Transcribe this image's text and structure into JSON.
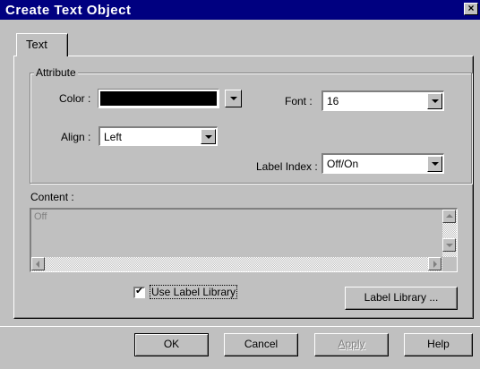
{
  "window": {
    "title": "Create Text Object",
    "close_glyph": "×"
  },
  "tabs": [
    {
      "label": "Text",
      "selected": true
    }
  ],
  "attribute": {
    "group_label": "Attribute",
    "color": {
      "label": "Color :",
      "value_color": "#000000"
    },
    "font": {
      "label": "Font :",
      "value": "16"
    },
    "align": {
      "label": "Align :",
      "value": "Left"
    },
    "label_index": {
      "label": "Label Index :",
      "value": "Off/On"
    }
  },
  "content": {
    "label": "Content :",
    "value": "Off"
  },
  "use_label_library": {
    "label": "Use Label Library",
    "checked": true,
    "check_glyph": "✔"
  },
  "label_library_button": "Label Library ...",
  "footer": {
    "ok": "OK",
    "cancel": "Cancel",
    "apply": "Apply",
    "help": "Help"
  },
  "colors": {
    "titlebar": "#000080",
    "face": "#c0c0c0",
    "disabled_text": "#808080"
  }
}
